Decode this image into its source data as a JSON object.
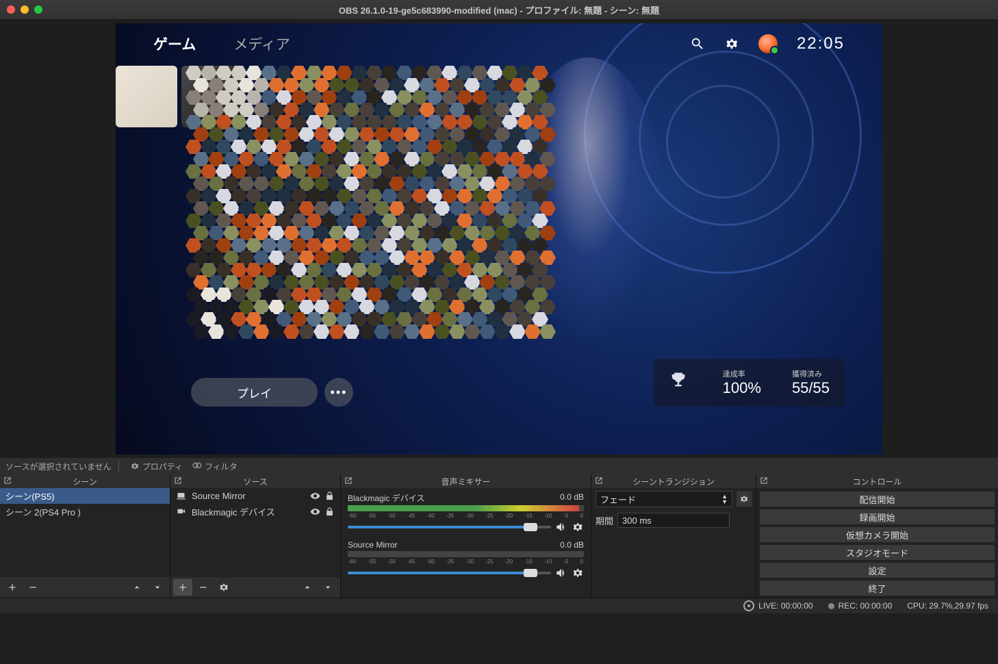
{
  "window": {
    "title": "OBS 26.1.0-19-ge5c683990-modified (mac) - プロファイル: 無題 - シーン: 無題"
  },
  "toolbar": {
    "noselect": "ソースが選択されていません",
    "properties": "プロパティ",
    "filters": "フィルタ"
  },
  "preview": {
    "nav": {
      "games": "ゲーム",
      "media": "メディア"
    },
    "clock": "22:05",
    "play": "プレイ",
    "trophy": {
      "completion_label": "達成率",
      "completion": "100%",
      "earned_label": "獲得済み",
      "earned": "55/55"
    }
  },
  "docks": {
    "scenes": {
      "title": "シーン",
      "items": [
        "シーン(PS5)",
        "シーン 2(PS4 Pro )"
      ]
    },
    "sources": {
      "title": "ソース",
      "items": [
        "Source Mirror",
        "Blackmagic デバイス"
      ]
    },
    "mixer": {
      "title": "音声ミキサー",
      "channels": [
        {
          "name": "Blackmagic デバイス",
          "db": "0.0 dB",
          "level": 98,
          "vol": 90
        },
        {
          "name": "Source Mirror",
          "db": "0.0 dB",
          "level": 0,
          "vol": 90
        }
      ],
      "ticks": [
        "-60",
        "-55",
        "-50",
        "-45",
        "-40",
        "-35",
        "-30",
        "-25",
        "-20",
        "-15",
        "-10",
        "-5",
        "0"
      ]
    },
    "transitions": {
      "title": "シーントランジション",
      "current": "フェード",
      "duration_label": "期間",
      "duration": "300 ms"
    },
    "controls": {
      "title": "コントロール",
      "buttons": [
        "配信開始",
        "録画開始",
        "仮想カメラ開始",
        "スタジオモード",
        "設定",
        "終了"
      ]
    }
  },
  "status": {
    "live": "LIVE: 00:00:00",
    "rec": "REC: 00:00:00",
    "cpu": "CPU: 29.7%,29.97 fps"
  },
  "colors": {
    "selection": "#3a5a8a",
    "accent": "#3c8cd8"
  }
}
